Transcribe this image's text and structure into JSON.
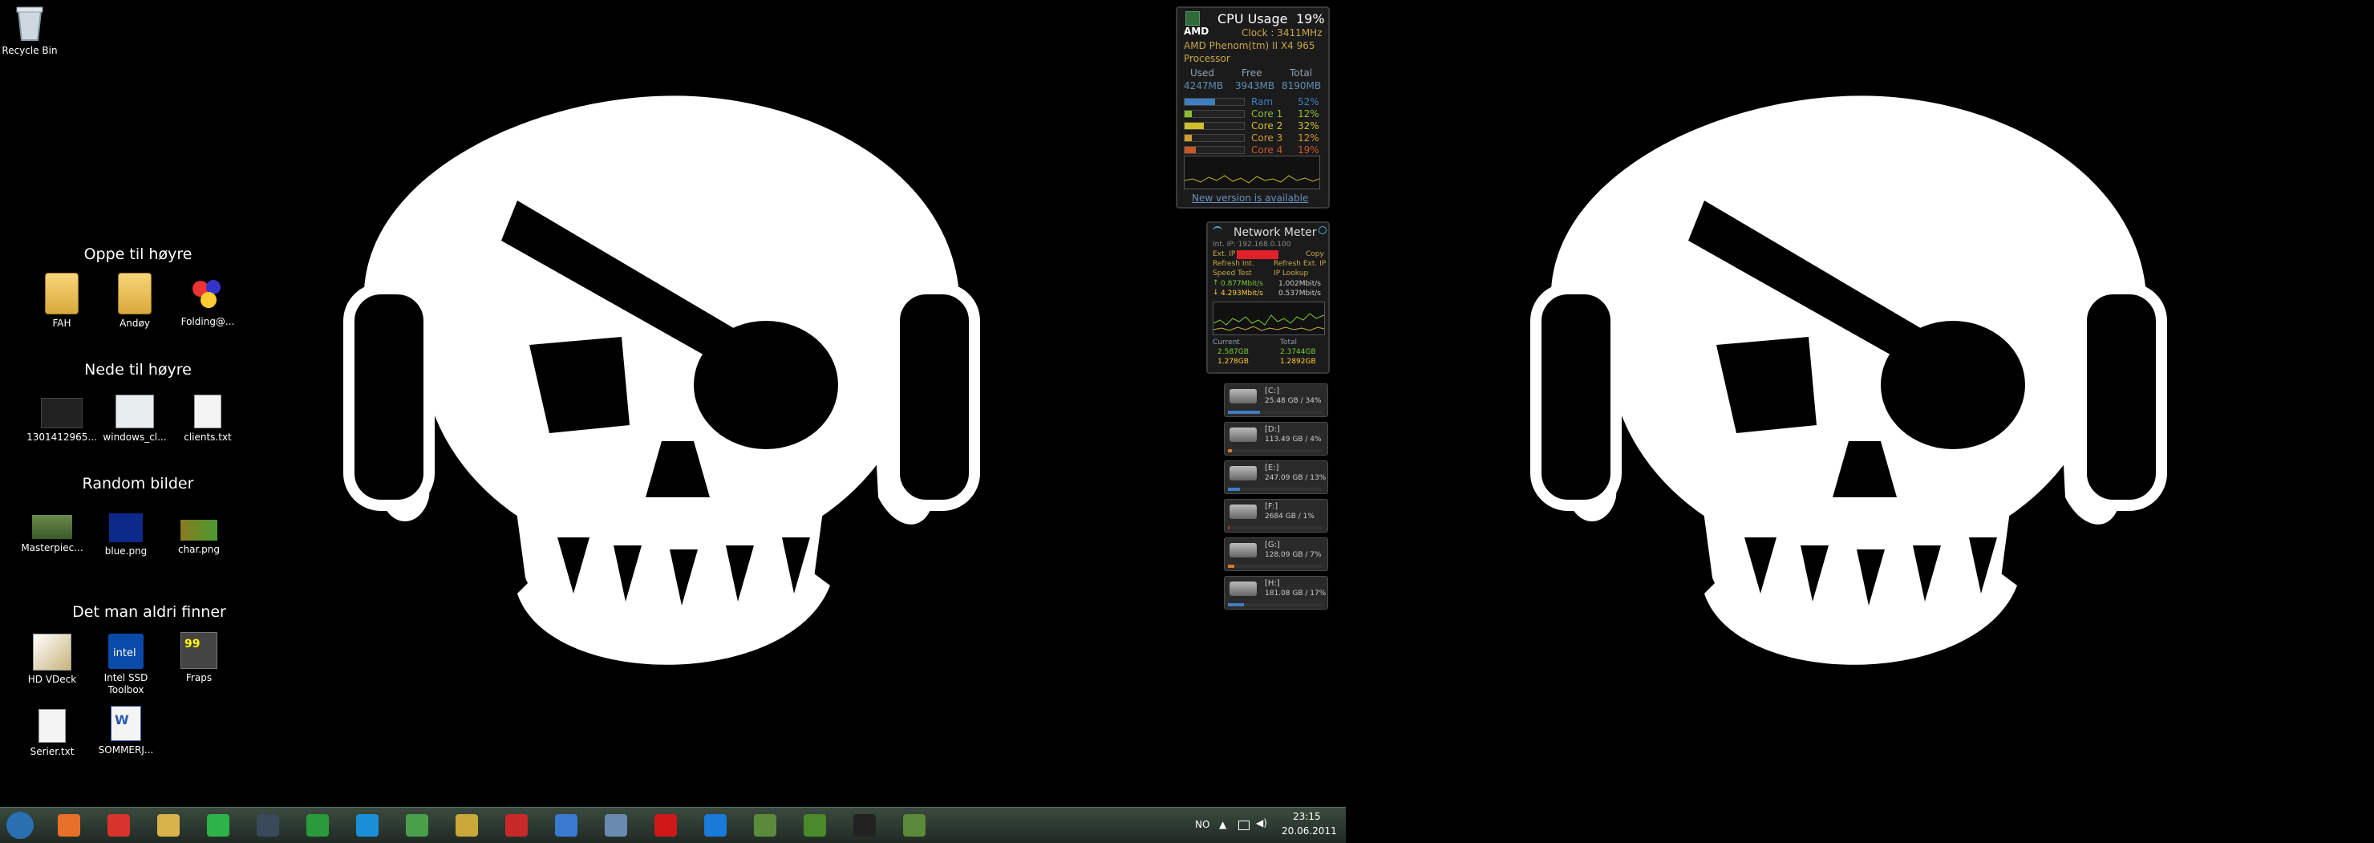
{
  "desktop": {
    "recycle_bin": "Recycle Bin",
    "groups": [
      {
        "title": "Oppe til høyre",
        "icons": [
          "FAH",
          "Andøy",
          "Folding@..."
        ]
      },
      {
        "title": "Nede til høyre",
        "icons": [
          "1301412965...",
          "windows_cl...",
          "clients.txt"
        ]
      },
      {
        "title": "Random bilder",
        "icons": [
          "Masterpiec...",
          "blue.png",
          "char.png"
        ]
      },
      {
        "title": "Det man aldri finner",
        "icons": [
          "HD VDeck",
          "Intel SSD\nToolbox",
          "Fraps",
          "Serier.txt",
          "SOMMERJ..."
        ]
      }
    ]
  },
  "cpu_gadget": {
    "title": "CPU Usage",
    "percent": "19%",
    "brand": "AMD",
    "clock": "Clock : 3411MHz",
    "processor": "AMD Phenom(tm) II X4 965",
    "processor_sub": "Processor",
    "headers": [
      "Used",
      "Free",
      "Total"
    ],
    "mem": [
      "4247MB",
      "3943MB",
      "8190MB"
    ],
    "rows": [
      {
        "label": "Ram",
        "pct": "52%",
        "fill": 0.52,
        "color": "#3d7fc1"
      },
      {
        "label": "Core 1",
        "pct": "12%",
        "fill": 0.12,
        "color": "#8cbf2d"
      },
      {
        "label": "Core 2",
        "pct": "32%",
        "fill": 0.32,
        "color": "#cfc02c"
      },
      {
        "label": "Core 3",
        "pct": "12%",
        "fill": 0.12,
        "color": "#d39b2c"
      },
      {
        "label": "Core 4",
        "pct": "19%",
        "fill": 0.19,
        "color": "#c85a28"
      }
    ],
    "link": "New version is available"
  },
  "net_gadget": {
    "title": "Network Meter",
    "int_ip": "Int. IP: 192.168.0.100",
    "ext_ip": "Ext. IP",
    "copy": "Copy",
    "refresh_int": "Refresh Int.",
    "refresh_ext": "Refresh Ext. IP",
    "speed_test": "Speed Test",
    "ip_lookup": "IP Lookup",
    "up_rate": "0.877Mbit/s",
    "up_rate2": "1.002Mbit/s",
    "down_rate": "4.293Mbit/s",
    "down_rate2": "0.537Mbit/s",
    "current": "Current",
    "total": "Total",
    "cur_up": "2.587GB",
    "cur_down": "1.278GB",
    "tot_up": "2.3744GB",
    "tot_down": "1.2892GB"
  },
  "drives": [
    {
      "name": "[C:]",
      "size": "25.48 GB / 34%",
      "fill": 0.34,
      "color": "#3d7fc1"
    },
    {
      "name": "[D:]",
      "size": "113.49 GB / 4%",
      "fill": 0.04,
      "color": "#d57a2a"
    },
    {
      "name": "[E:]",
      "size": "247.09 GB / 13%",
      "fill": 0.13,
      "color": "#3d7fc1"
    },
    {
      "name": "[F:]",
      "size": "2684 GB / 1%",
      "fill": 0.01,
      "color": "#c2283a"
    },
    {
      "name": "[G:]",
      "size": "128.09 GB / 7%",
      "fill": 0.07,
      "color": "#d57a2a"
    },
    {
      "name": "[H:]",
      "size": "181.08 GB / 17%",
      "fill": 0.17,
      "color": "#3d7fc1"
    }
  ],
  "taskbar": {
    "apps": [
      "start-orb",
      "firefox",
      "chrome",
      "explorer",
      "spotify",
      "steam",
      "utorrent",
      "skype",
      "messenger",
      "notepad",
      "flashget",
      "folding",
      "device",
      "ati",
      "teamviewer",
      "minecraft",
      "minecraft2",
      "cmd",
      "minecraft3"
    ],
    "lang": "NO",
    "time": "23:15",
    "date": "20.06.2011"
  }
}
